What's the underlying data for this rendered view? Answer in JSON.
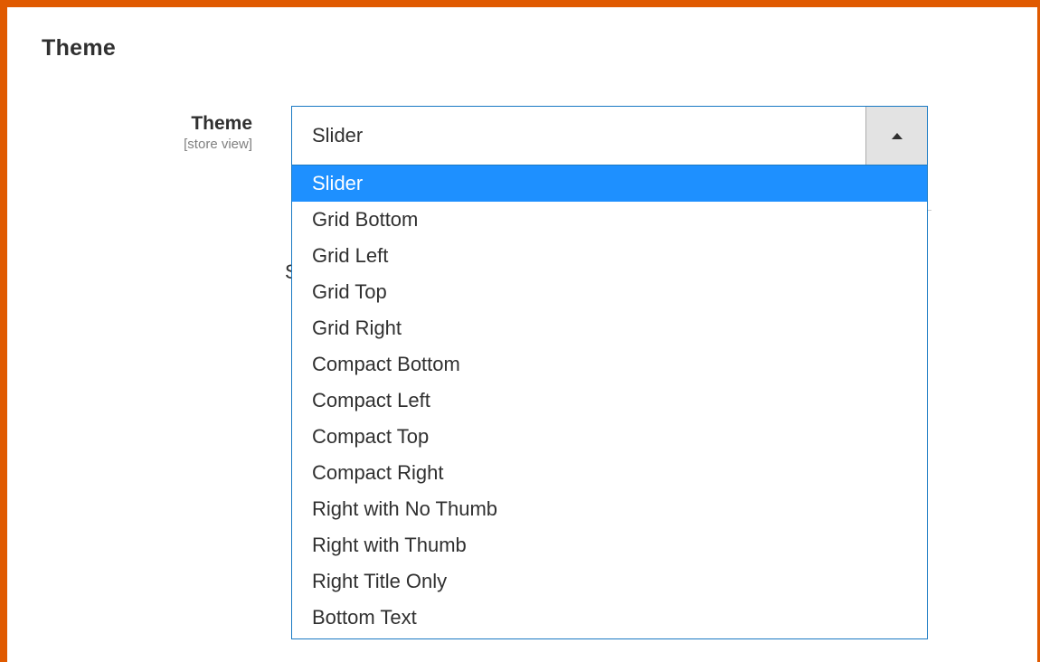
{
  "section": {
    "title": "Theme"
  },
  "field": {
    "label": "Theme",
    "scope": "[store view]",
    "selected_value": "Slider",
    "options": [
      "Slider",
      "Grid Bottom",
      "Grid Left",
      "Grid Top",
      "Grid Right",
      "Compact Bottom",
      "Compact Left",
      "Compact Top",
      "Compact Right",
      "Right with No Thumb",
      "Right with Thumb",
      "Right Title Only",
      "Bottom Text"
    ],
    "highlighted_index": 0
  },
  "hidden_behind_dropdown": {
    "glyph": "S"
  },
  "colors": {
    "accent_border": "#e05a00",
    "focus_border": "#1979c3",
    "highlight": "#1e90ff"
  },
  "icons": {
    "dropdown_toggle": "triangle-up-icon"
  }
}
